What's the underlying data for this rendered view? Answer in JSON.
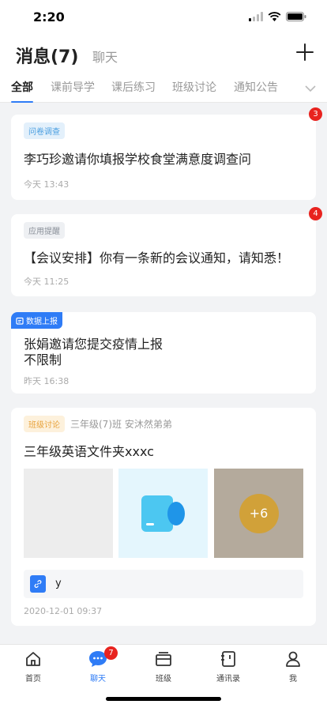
{
  "status_bar": {
    "time": "2:20"
  },
  "header": {
    "title": "消息(7)",
    "chat_tab": "聊天"
  },
  "tabs": [
    {
      "label": "全部",
      "active": true
    },
    {
      "label": "课前导学"
    },
    {
      "label": "课后练习"
    },
    {
      "label": "班级讨论"
    },
    {
      "label": "通知公告"
    }
  ],
  "messages": [
    {
      "tag": "问卷调查",
      "title": "李巧珍邀请你填报学校食堂满意度调查问",
      "time": "今天 13:43",
      "badge": "3"
    },
    {
      "tag": "应用提醒",
      "title": "【会议安排】你有一条新的会议通知，请知悉！",
      "time": "今天 11:25",
      "badge": "4"
    },
    {
      "tag": "数据上报",
      "title_line1": "张娟邀请您提交疫情上报",
      "title_line2": "不限制",
      "time": "昨天 16:38"
    },
    {
      "tag": "班级讨论",
      "subtitle": "三年级(7)班 安沐然弟弟",
      "title": "三年级英语文件夹xxxc",
      "more_count": "+6",
      "file_name": "y",
      "time": "2020-12-01 09:37"
    }
  ],
  "tabbar": [
    {
      "label": "首页"
    },
    {
      "label": "聊天",
      "badge": "7",
      "active": true
    },
    {
      "label": "班级"
    },
    {
      "label": "通讯录"
    },
    {
      "label": "我"
    }
  ],
  "colors": {
    "accent": "#2f7cf6",
    "badge": "#e8231f"
  }
}
